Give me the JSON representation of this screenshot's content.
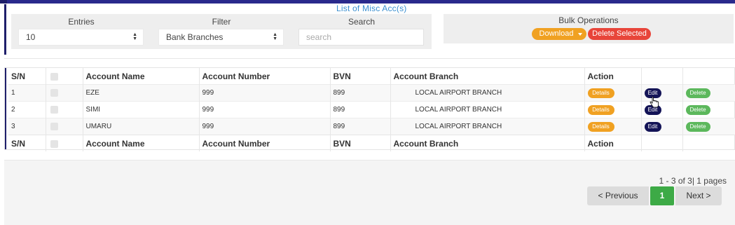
{
  "page_title": "List of Misc Acc(s)",
  "filters": {
    "entries_label": "Entries",
    "entries_value": "10",
    "filter_label": "Filter",
    "filter_value": "Bank Branches",
    "search_label": "Search",
    "search_placeholder": "search"
  },
  "bulk": {
    "label": "Bulk Operations",
    "download_label": "Download",
    "delete_selected_label": "Delete Selected"
  },
  "table": {
    "headers": [
      "S/N",
      "",
      "Account Name",
      "Account Number",
      "BVN",
      "Account Branch",
      "Action",
      "",
      ""
    ],
    "rows": [
      {
        "sn": "1",
        "name": "EZE",
        "number": "999",
        "bvn": "899",
        "branch": "LOCAL AIRPORT BRANCH"
      },
      {
        "sn": "2",
        "name": "SIMI",
        "number": "999",
        "bvn": "899",
        "branch": "LOCAL AIRPORT BRANCH"
      },
      {
        "sn": "3",
        "name": "UMARU",
        "number": "999",
        "bvn": "899",
        "branch": "LOCAL AIRPORT BRANCH"
      }
    ],
    "details_label": "Details",
    "edit_label": "Edit",
    "delete_label": "Delete"
  },
  "pagination": {
    "summary": "1 - 3 of 3| 1 pages",
    "previous_label": "< Previous",
    "current_page": "1",
    "next_label": "Next >"
  },
  "colors": {
    "accent_navy": "#1f1f6b",
    "download_orange": "#f0a122",
    "delete_red": "#e8453a",
    "delete_green": "#5cb85c",
    "edit_navy": "#141457",
    "page_green": "#3daa46"
  }
}
